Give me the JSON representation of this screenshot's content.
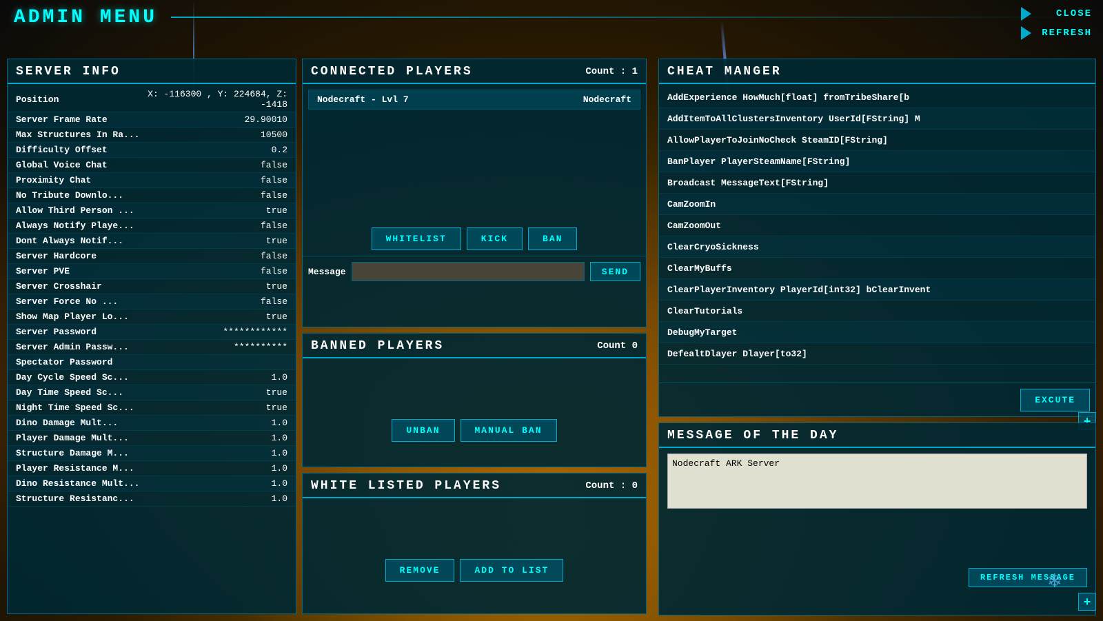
{
  "app": {
    "title": "ADMIN  MENU",
    "close_label": "CLOSE",
    "refresh_label": "REFRESH"
  },
  "server_info": {
    "title": "SERVER  INFO",
    "rows": [
      {
        "label": "Position",
        "value": "X: -116300 , Y: 224684, Z: -1418"
      },
      {
        "label": "Server Frame Rate",
        "value": "29.90010"
      },
      {
        "label": "Max Structures In Ra...",
        "value": "10500"
      },
      {
        "label": "Difficulty Offset",
        "value": "0.2"
      },
      {
        "label": "Global Voice Chat",
        "value": "false"
      },
      {
        "label": "Proximity Chat",
        "value": "false"
      },
      {
        "label": "No Tribute Downlo...",
        "value": "false"
      },
      {
        "label": "Allow Third Person ...",
        "value": "true"
      },
      {
        "label": "Always Notify Playe...",
        "value": "false"
      },
      {
        "label": "Dont Always Notif...",
        "value": "true"
      },
      {
        "label": "Server Hardcore",
        "value": "false"
      },
      {
        "label": "Server PVE",
        "value": "false"
      },
      {
        "label": "Server Crosshair",
        "value": "true"
      },
      {
        "label": "Server Force No ...",
        "value": "false"
      },
      {
        "label": "Show Map Player Lo...",
        "value": "true"
      },
      {
        "label": "Server Password",
        "value": "************"
      },
      {
        "label": "Server Admin Passw...",
        "value": "**********"
      },
      {
        "label": "Spectator Password",
        "value": ""
      },
      {
        "label": "Day Cycle Speed Sc...",
        "value": "1.0"
      },
      {
        "label": "Day Time Speed Sc...",
        "value": "true"
      },
      {
        "label": "Night Time Speed Sc...",
        "value": "true"
      },
      {
        "label": "Dino Damage Mult...",
        "value": "1.0"
      },
      {
        "label": "Player Damage Mult...",
        "value": "1.0"
      },
      {
        "label": "Structure Damage M...",
        "value": "1.0"
      },
      {
        "label": "Player Resistance M...",
        "value": "1.0"
      },
      {
        "label": "Dino Resistance Mult...",
        "value": "1.0"
      },
      {
        "label": "Structure Resistanc...",
        "value": "1.0"
      }
    ]
  },
  "connected_players": {
    "title": "CONNECTED  PLAYERS",
    "count_label": "Count : 1",
    "players": [
      {
        "name": "Nodecraft - Lvl 7",
        "steam": "Nodecraft"
      }
    ],
    "whitelist_btn": "WHITELIST",
    "kick_btn": "KICK",
    "ban_btn": "BAN",
    "message_label": "Message",
    "message_placeholder": "",
    "send_btn": "SEND"
  },
  "banned_players": {
    "title": "BANNED  PLAYERS",
    "count_label": "Count  0",
    "players": [],
    "unban_btn": "UNBAN",
    "manual_ban_btn": "Manual Ban"
  },
  "white_listed_players": {
    "title": "WHITE  LISTED  PLAYERS",
    "count_label": "Count : 0",
    "players": [],
    "remove_btn": "REMOVE",
    "add_btn": "ADD TO LIST"
  },
  "cheat_manager": {
    "title": "CHEAT  MANGER",
    "items": [
      "AddExperience HowMuch[float] fromTribeShare[b",
      "AddItemToAllClustersInventory UserId[FString] M",
      "AllowPlayerToJoinNoCheck SteamID[FString]",
      "BanPlayer PlayerSteamName[FString]",
      "Broadcast MessageText[FString]",
      "CamZoomIn",
      "CamZoomOut",
      "ClearCryoSickness",
      "ClearMyBuffs",
      "ClearPlayerInventory PlayerId[int32] bClearInvent",
      "ClearTutorials",
      "DebugMyTarget",
      "DefealtDlayer Dlayer[to32]"
    ],
    "excute_btn": "EXCUTE"
  },
  "message_of_the_day": {
    "title": "MESSAGE   OF   THE   DAY",
    "content": "Nodecraft ARK Server",
    "refresh_btn": "REFRESH MESSAGE"
  },
  "icons": {
    "plus": "+",
    "snowflake": "❄"
  }
}
